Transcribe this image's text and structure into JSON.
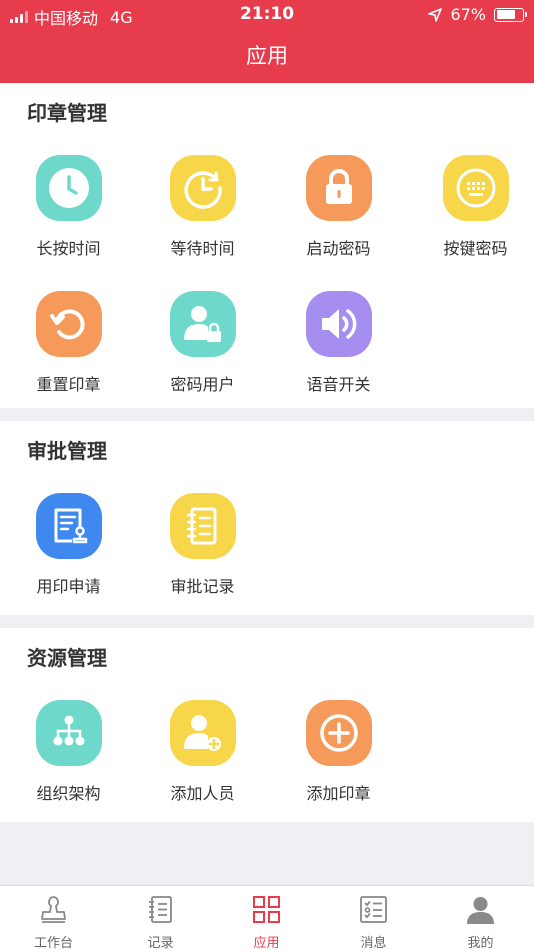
{
  "status_bar": {
    "carrier": "中国移动",
    "network": "4G",
    "time": "21:10",
    "battery_percent": "67%",
    "battery_level": 0.67
  },
  "header": {
    "title": "应用"
  },
  "sections": [
    {
      "title": "印章管理",
      "items": [
        {
          "label": "长按时间",
          "icon": "clock-icon",
          "color": "#6ed8cb"
        },
        {
          "label": "等待时间",
          "icon": "timer-icon",
          "color": "#f8d64a"
        },
        {
          "label": "启动密码",
          "icon": "lock-icon",
          "color": "#f59a5a"
        },
        {
          "label": "按键密码",
          "icon": "keypad-icon",
          "color": "#f8d64a"
        },
        {
          "label": "重置印章",
          "icon": "reset-icon",
          "color": "#f59a5a"
        },
        {
          "label": "密码用户",
          "icon": "user-lock-icon",
          "color": "#6ed8cb"
        },
        {
          "label": "语音开关",
          "icon": "speaker-icon",
          "color": "#a58ef0"
        }
      ]
    },
    {
      "title": "审批管理",
      "items": [
        {
          "label": "用印申请",
          "icon": "seal-application-icon",
          "color": "#3f88f0"
        },
        {
          "label": "审批记录",
          "icon": "notebook-icon",
          "color": "#f8d64a"
        }
      ]
    },
    {
      "title": "资源管理",
      "items": [
        {
          "label": "组织架构",
          "icon": "org-chart-icon",
          "color": "#6ed8cb"
        },
        {
          "label": "添加人员",
          "icon": "add-user-icon",
          "color": "#f8d64a"
        },
        {
          "label": "添加印章",
          "icon": "add-circle-icon",
          "color": "#f59a5a"
        }
      ]
    }
  ],
  "tab_bar": {
    "active": "应用",
    "accent_color": "#e63c4c",
    "items": [
      {
        "label": "工作台",
        "icon": "stamp-icon"
      },
      {
        "label": "记录",
        "icon": "record-book-icon"
      },
      {
        "label": "应用",
        "icon": "apps-grid-icon"
      },
      {
        "label": "消息",
        "icon": "checklist-icon"
      },
      {
        "label": "我的",
        "icon": "profile-icon"
      }
    ]
  }
}
